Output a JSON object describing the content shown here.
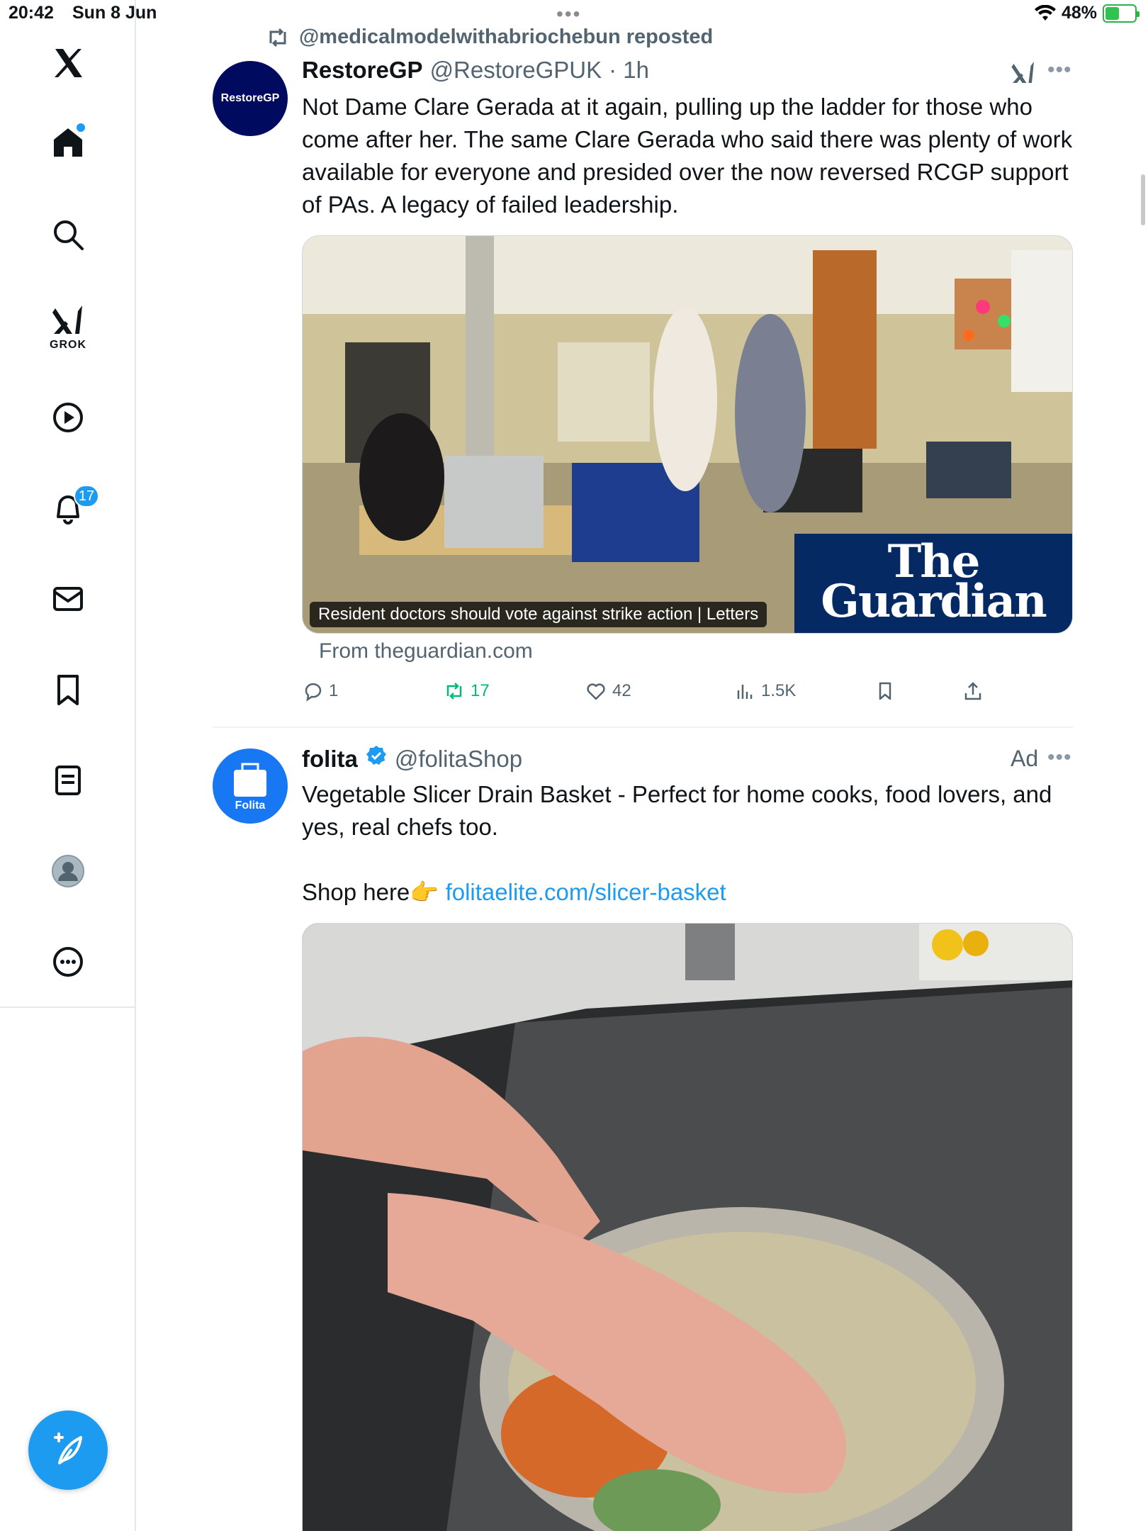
{
  "status_bar": {
    "time": "20:42",
    "date": "Sun 8 Jun",
    "battery": "48%",
    "battery_level": 0.48,
    "top_dots": "•••"
  },
  "sidebar": {
    "logo": "x-logo-icon",
    "items": [
      {
        "name": "home",
        "icon": "home-icon"
      },
      {
        "name": "search",
        "icon": "search-icon"
      },
      {
        "name": "grok",
        "icon": "grok-icon",
        "label": "GROK"
      },
      {
        "name": "video",
        "icon": "play-icon"
      },
      {
        "name": "notifications",
        "icon": "bell-icon",
        "badge": "17"
      },
      {
        "name": "messages",
        "icon": "mail-icon"
      },
      {
        "name": "bookmarks",
        "icon": "bookmark-icon"
      },
      {
        "name": "lists",
        "icon": "list-icon"
      },
      {
        "name": "profile",
        "icon": "avatar-icon"
      },
      {
        "name": "more",
        "icon": "more-circle-icon"
      }
    ],
    "compose_icon": "compose-icon"
  },
  "colors": {
    "accent": "#1d9bf0",
    "repost_green": "#00ba7c",
    "guardian_blue": "#052962",
    "restore_navy": "#000a5e"
  },
  "tweets": [
    {
      "repost_by": "@medicalmodelwithabriochebun reposted",
      "avatar_text": "RestoreGP",
      "name": "RestoreGP",
      "handle": "@RestoreGPUK",
      "time": "· 1h",
      "text": "Not Dame Clare Gerada at it again, pulling up the ladder for those who come after her. The same Clare Gerada who said there was plenty of work available for everyone and presided over the now reversed RCGP support of PAs. A legacy of failed leadership.",
      "card": {
        "caption": "Resident doctors should vote against strike action | Letters",
        "brand_line1": "The",
        "brand_line2": "Guardian",
        "from": "From theguardian.com"
      },
      "stats": {
        "replies": "1",
        "reposts": "17",
        "likes": "42",
        "views": "1.5K"
      }
    },
    {
      "avatar_text": "Folita",
      "name": "folita",
      "handle": "@folitaShop",
      "ad_label": "Ad",
      "text_line1": "Vegetable Slicer Drain Basket - Perfect for home cooks, food lovers, and yes, real chefs too.",
      "text_line2": "Shop here👉",
      "link": "folitaelite.com/slicer-basket"
    }
  ]
}
